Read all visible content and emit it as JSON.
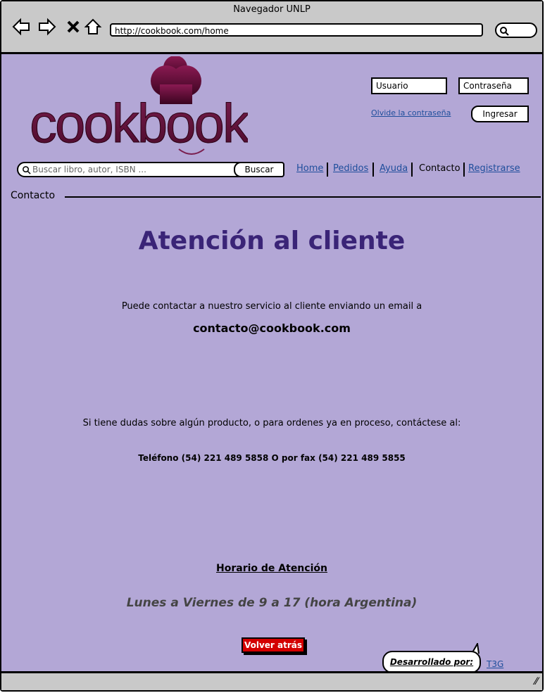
{
  "window": {
    "title": "Navegador UNLP",
    "url": "http://cookbook.com/home"
  },
  "logo": {
    "text": "cookbook"
  },
  "login": {
    "user_placeholder": "Usuario",
    "password_placeholder": "Contraseña",
    "forgot_label": "Olvide la contraseña",
    "submit_label": "Ingresar"
  },
  "search": {
    "placeholder": "Buscar libro, autor, ISBN ...",
    "button_label": "Buscar"
  },
  "nav": {
    "home": "Home",
    "pedidos": "Pedidos",
    "ayuda": "Ayuda",
    "contacto": "Contacto",
    "registrarse": " Registrarse"
  },
  "breadcrumb": "Contacto",
  "content": {
    "title": "Atención al cliente",
    "intro": "Puede contactar a nuestro servicio al cliente enviando un email a",
    "email": "contacto@cookbook.com",
    "dudas": "Si tiene dudas sobre algún producto, o para ordenes ya en proceso, contáctese al:",
    "telefono": "Teléfono (54) 221 489 5858 O por fax (54) 221 489 5855",
    "horario_label": "Horario de Atención",
    "horario": "Lunes a Viernes de 9 a 17 (hora Argentina)",
    "back_label": "Volver atrás"
  },
  "footer": {
    "developed_by": "Desarrollado por:",
    "team": "T3G"
  },
  "colors": {
    "background": "#b3a7d6",
    "title": "#3a2477",
    "logo": "#6a0a3a",
    "back_button": "#d40000",
    "link": "#1f4e9c"
  }
}
